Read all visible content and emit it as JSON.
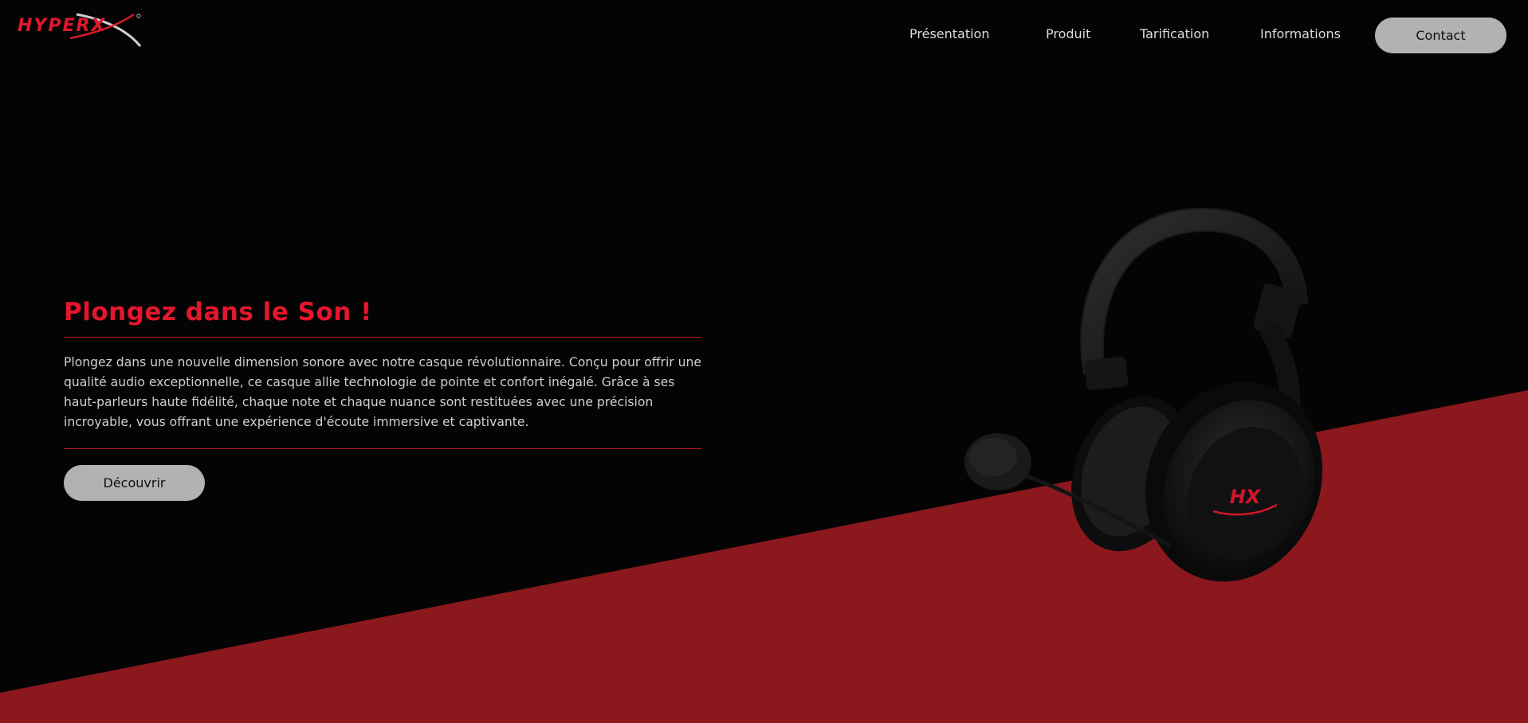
{
  "brand": {
    "name": "HYPERX",
    "accent": "#e4162d",
    "logo_icon": "hyperx-logo"
  },
  "nav": {
    "links": [
      "Présentation",
      "Produit",
      "Tarification",
      "Informations"
    ],
    "contact_label": "Contact"
  },
  "hero": {
    "title": "Plongez dans le Son !",
    "body": "Plongez dans une nouvelle dimension sonore avec notre casque révolutionnaire. Conçu pour offrir une qualité audio exceptionnelle, ce casque allie technologie de pointe et confort inégalé. Grâce à ses haut-parleurs haute fidélité, chaque note et chaque nuance sont restituées avec une précision incroyable, vous offrant une expérience d'écoute immersive et captivante.",
    "cta_label": "Découvrir"
  },
  "product_image": {
    "icon": "headset-image",
    "headset_logo": "HX"
  },
  "colors": {
    "background": "#040404",
    "band": "#8b181d",
    "button": "#b2b2b2"
  }
}
